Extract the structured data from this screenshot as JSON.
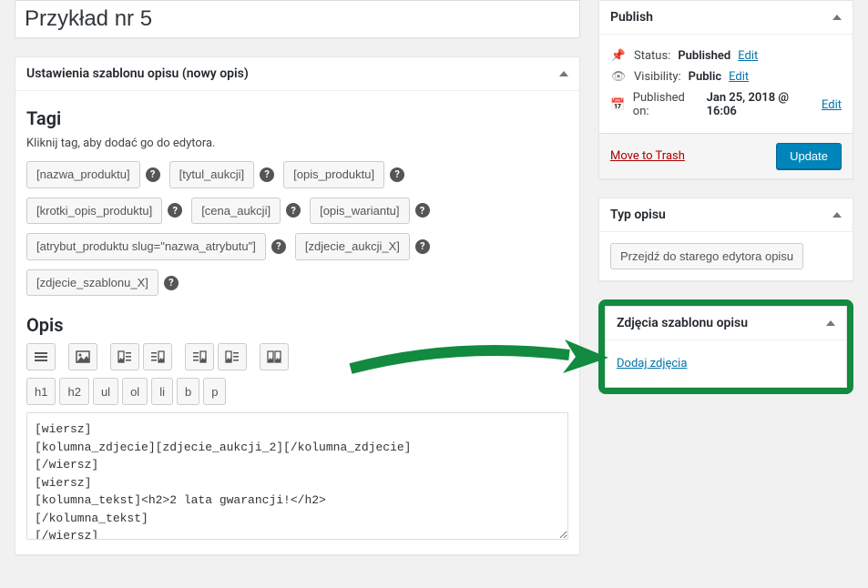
{
  "title": "Przykład nr 5",
  "template_box": {
    "header": "Ustawienia szablonu opisu (nowy opis)",
    "tags_title": "Tagi",
    "tags_hint": "Kliknij tag, aby dodać go do edytora.",
    "tags": [
      "[nazwa_produktu]",
      "[tytul_aukcji]",
      "[opis_produktu]",
      "[krotki_opis_produktu]",
      "[cena_aukcji]",
      "[opis_wariantu]",
      "[atrybut_produktu slug=\"nazwa_atrybutu\"]",
      "[zdjecie_aukcji_X]",
      "[zdjecie_szablonu_X]"
    ],
    "desc_title": "Opis",
    "format_buttons": [
      "h1",
      "h2",
      "ul",
      "ol",
      "li",
      "b",
      "p"
    ],
    "code": "[wiersz]\n[kolumna_zdjecie][zdjecie_aukcji_2][/kolumna_zdjecie]\n[/wiersz]\n[wiersz]\n[kolumna_tekst]<h2>2 lata gwarancji!</h2>\n[/kolumna_tekst]\n[/wiersz]"
  },
  "publish_box": {
    "header": "Publish",
    "status_label": "Status:",
    "status_value": "Published",
    "visibility_label": "Visibility:",
    "visibility_value": "Public",
    "published_label": "Published on:",
    "published_value": "Jan 25, 2018 @ 16:06",
    "edit": "Edit",
    "trash": "Move to Trash",
    "update": "Update"
  },
  "type_box": {
    "header": "Typ opisu",
    "button": "Przejdź do starego edytora opisu"
  },
  "images_box": {
    "header": "Zdjęcia szablonu opisu",
    "add": "Dodaj zdjęcia"
  }
}
